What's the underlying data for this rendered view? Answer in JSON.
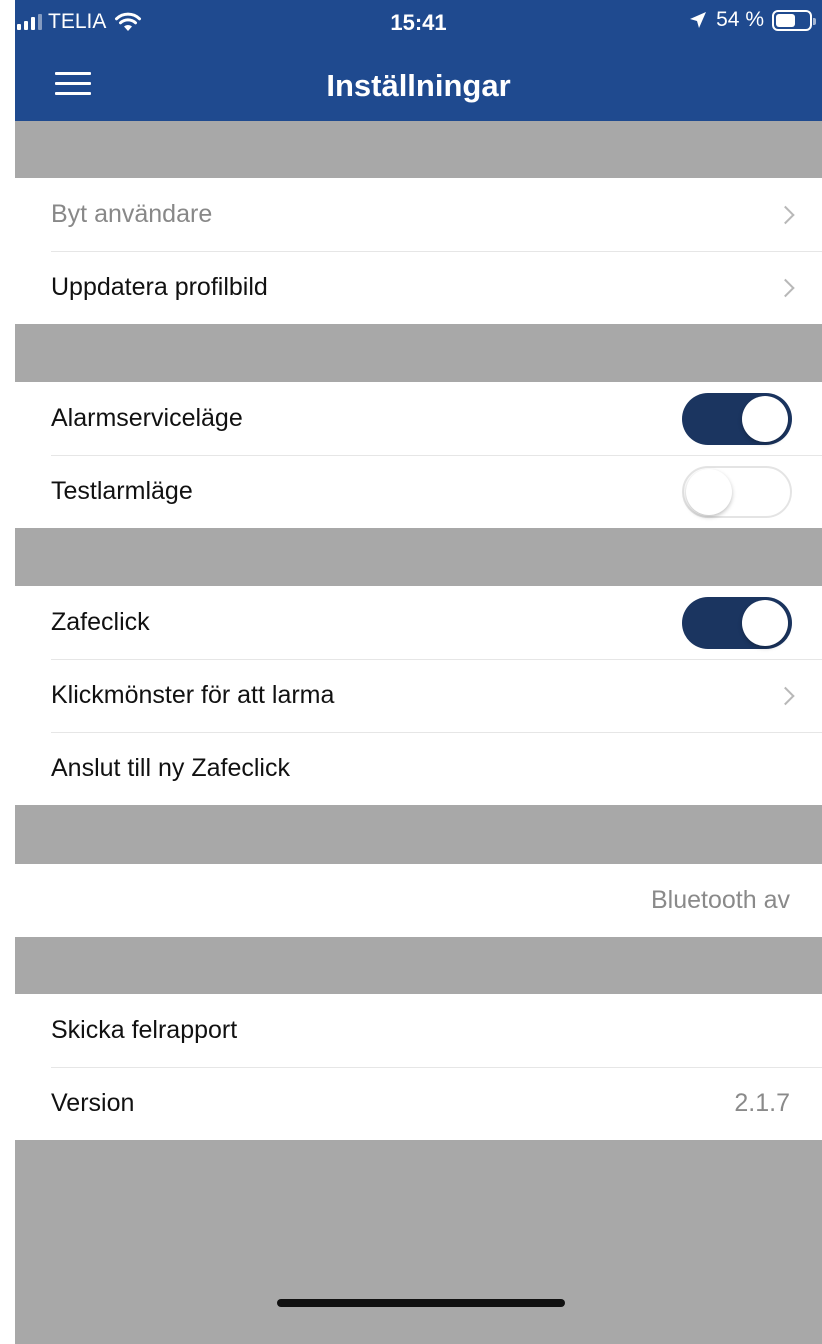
{
  "status_bar": {
    "carrier": "TELIA",
    "time": "15:41",
    "battery_percent": "54 %",
    "battery_level": 0.54
  },
  "nav": {
    "title": "Inställningar"
  },
  "groups": {
    "account": {
      "switch_user": "Byt användare",
      "update_profile_picture": "Uppdatera profilbild"
    },
    "modes": {
      "alarm_service_mode": {
        "label": "Alarmserviceläge",
        "enabled": true
      },
      "test_alarm_mode": {
        "label": "Testlarmläge",
        "enabled": false
      }
    },
    "zafeclick": {
      "zafeclick": {
        "label": "Zafeclick",
        "enabled": true
      },
      "click_pattern": "Klickmönster för att larma",
      "connect_new": "Anslut till ny Zafeclick"
    },
    "bluetooth": {
      "status": "Bluetooth av"
    },
    "about": {
      "send_report": "Skicka felrapport",
      "version_label": "Version",
      "version_value": "2.1.7"
    }
  },
  "colors": {
    "nav_background": "#1f4a8f",
    "toggle_on": "#1b3560",
    "section_gap": "#a8a8a8"
  }
}
